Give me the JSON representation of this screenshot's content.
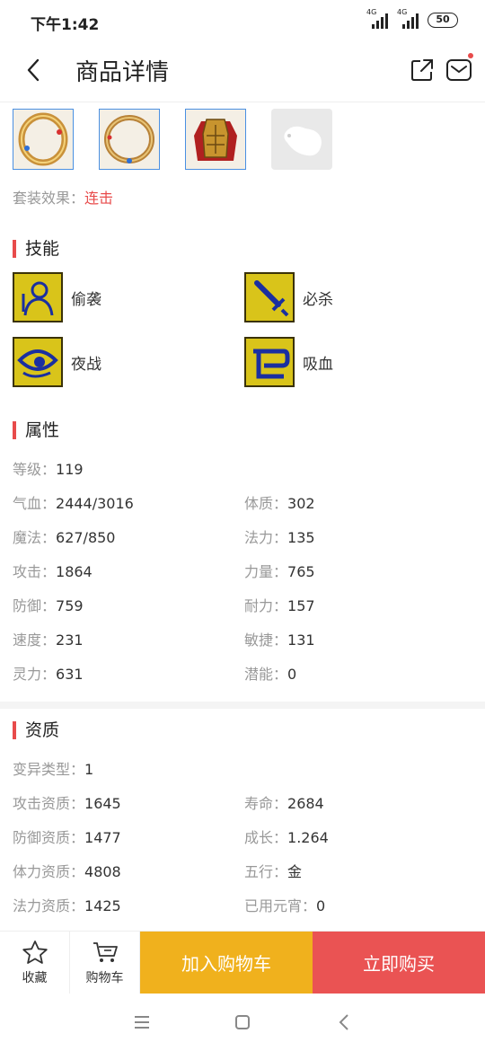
{
  "status": {
    "time": "下午1:42",
    "net1": "4G",
    "net2": "4G",
    "battery": "50"
  },
  "nav": {
    "title": "商品详情"
  },
  "items": [
    {
      "name": "ring-gold"
    },
    {
      "name": "ring-gold-2"
    },
    {
      "name": "armor"
    },
    {
      "name": "empty-slot"
    }
  ],
  "set": {
    "label": "套装效果：",
    "value": "连击"
  },
  "skills": {
    "title": "技能",
    "list": [
      "偷袭",
      "必杀",
      "夜战",
      "吸血"
    ]
  },
  "attributes": {
    "title": "属性",
    "rows": [
      {
        "label": "等级：",
        "value": "119"
      },
      {
        "label": "气血：",
        "value": "2444/3016"
      },
      {
        "label": "体质：",
        "value": "302"
      },
      {
        "label": "魔法：",
        "value": "627/850"
      },
      {
        "label": "法力：",
        "value": "135"
      },
      {
        "label": "攻击：",
        "value": "1864"
      },
      {
        "label": "力量：",
        "value": "765"
      },
      {
        "label": "防御：",
        "value": "759"
      },
      {
        "label": "耐力：",
        "value": "157"
      },
      {
        "label": "速度：",
        "value": "231"
      },
      {
        "label": "敏捷：",
        "value": "131"
      },
      {
        "label": "灵力：",
        "value": "631"
      },
      {
        "label": "潜能：",
        "value": "0"
      }
    ]
  },
  "quality": {
    "title": "资质",
    "rows": [
      {
        "label": "变异类型：",
        "value": "1"
      },
      {
        "label": "攻击资质：",
        "value": "1645"
      },
      {
        "label": "寿命：",
        "value": "2684"
      },
      {
        "label": "防御资质：",
        "value": "1477"
      },
      {
        "label": "成长：",
        "value": "1.264"
      },
      {
        "label": "体力资质：",
        "value": "4808"
      },
      {
        "label": "五行：",
        "value": "金"
      },
      {
        "label": "法力资质：",
        "value": "1425"
      },
      {
        "label": "已用元宵：",
        "value": "0"
      }
    ]
  },
  "bottom": {
    "favorite": "收藏",
    "cart": "购物车",
    "add_cart": "加入购物车",
    "buy_now": "立即购买"
  },
  "colors": {
    "accent_red": "#e84b4b",
    "cart_yellow": "#f0b11d",
    "buy_red": "#ea5353"
  }
}
